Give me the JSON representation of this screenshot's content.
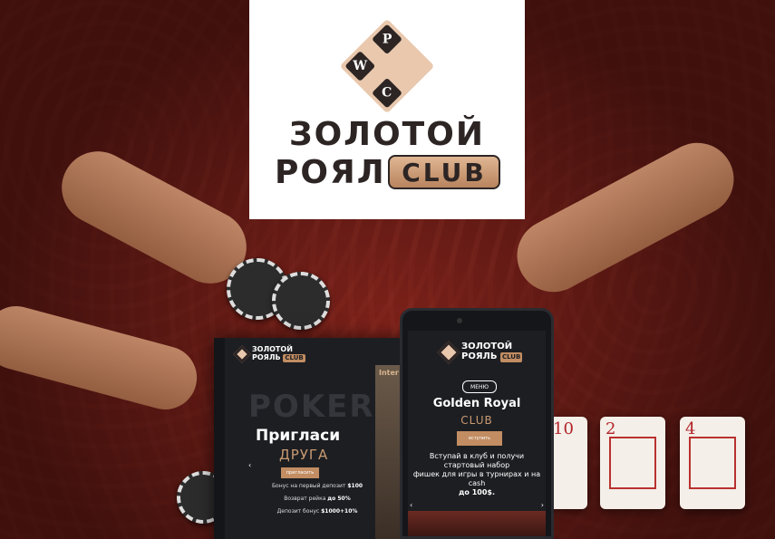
{
  "logo": {
    "letters": [
      "P",
      "W",
      "C"
    ],
    "line1": "ЗОЛОТОЙ",
    "line2": "РОЯЛЬ",
    "badge": "CLUB"
  },
  "laptop": {
    "logo_line1": "ЗОЛОТОЙ",
    "logo_line2": "РОЯЛЬ",
    "logo_badge": "CLUB",
    "bg_word": "POKER",
    "headline": "Пригласи",
    "subheadline": "ДРУГА",
    "button": "пригласить",
    "bonus1_text": "Бонус на первый депозит",
    "bonus1_value": "$100",
    "bonus2_text": "Возврат рейка",
    "bonus2_value": "до 50%",
    "bonus3_text": "Депозит бонус",
    "bonus3_value": "$1000+10%",
    "side_photo_text": "Inter GOL"
  },
  "phone": {
    "logo_line1": "ЗОЛОТОЙ",
    "logo_line2": "РОЯЛЬ",
    "logo_badge": "CLUB",
    "menu": "МЕНЮ",
    "title": "Golden Royal",
    "club": "CLUB",
    "button": "вступить",
    "text1": "Вступай в клуб и получи стартовый набор",
    "text2": "фишек для игры в турнирах и на cash",
    "text3": "до 100$."
  },
  "cards": [
    "2",
    "4",
    "10"
  ],
  "colors": {
    "accent": "#c28d62",
    "dark": "#1d1e22",
    "brand": "#2d2524"
  }
}
